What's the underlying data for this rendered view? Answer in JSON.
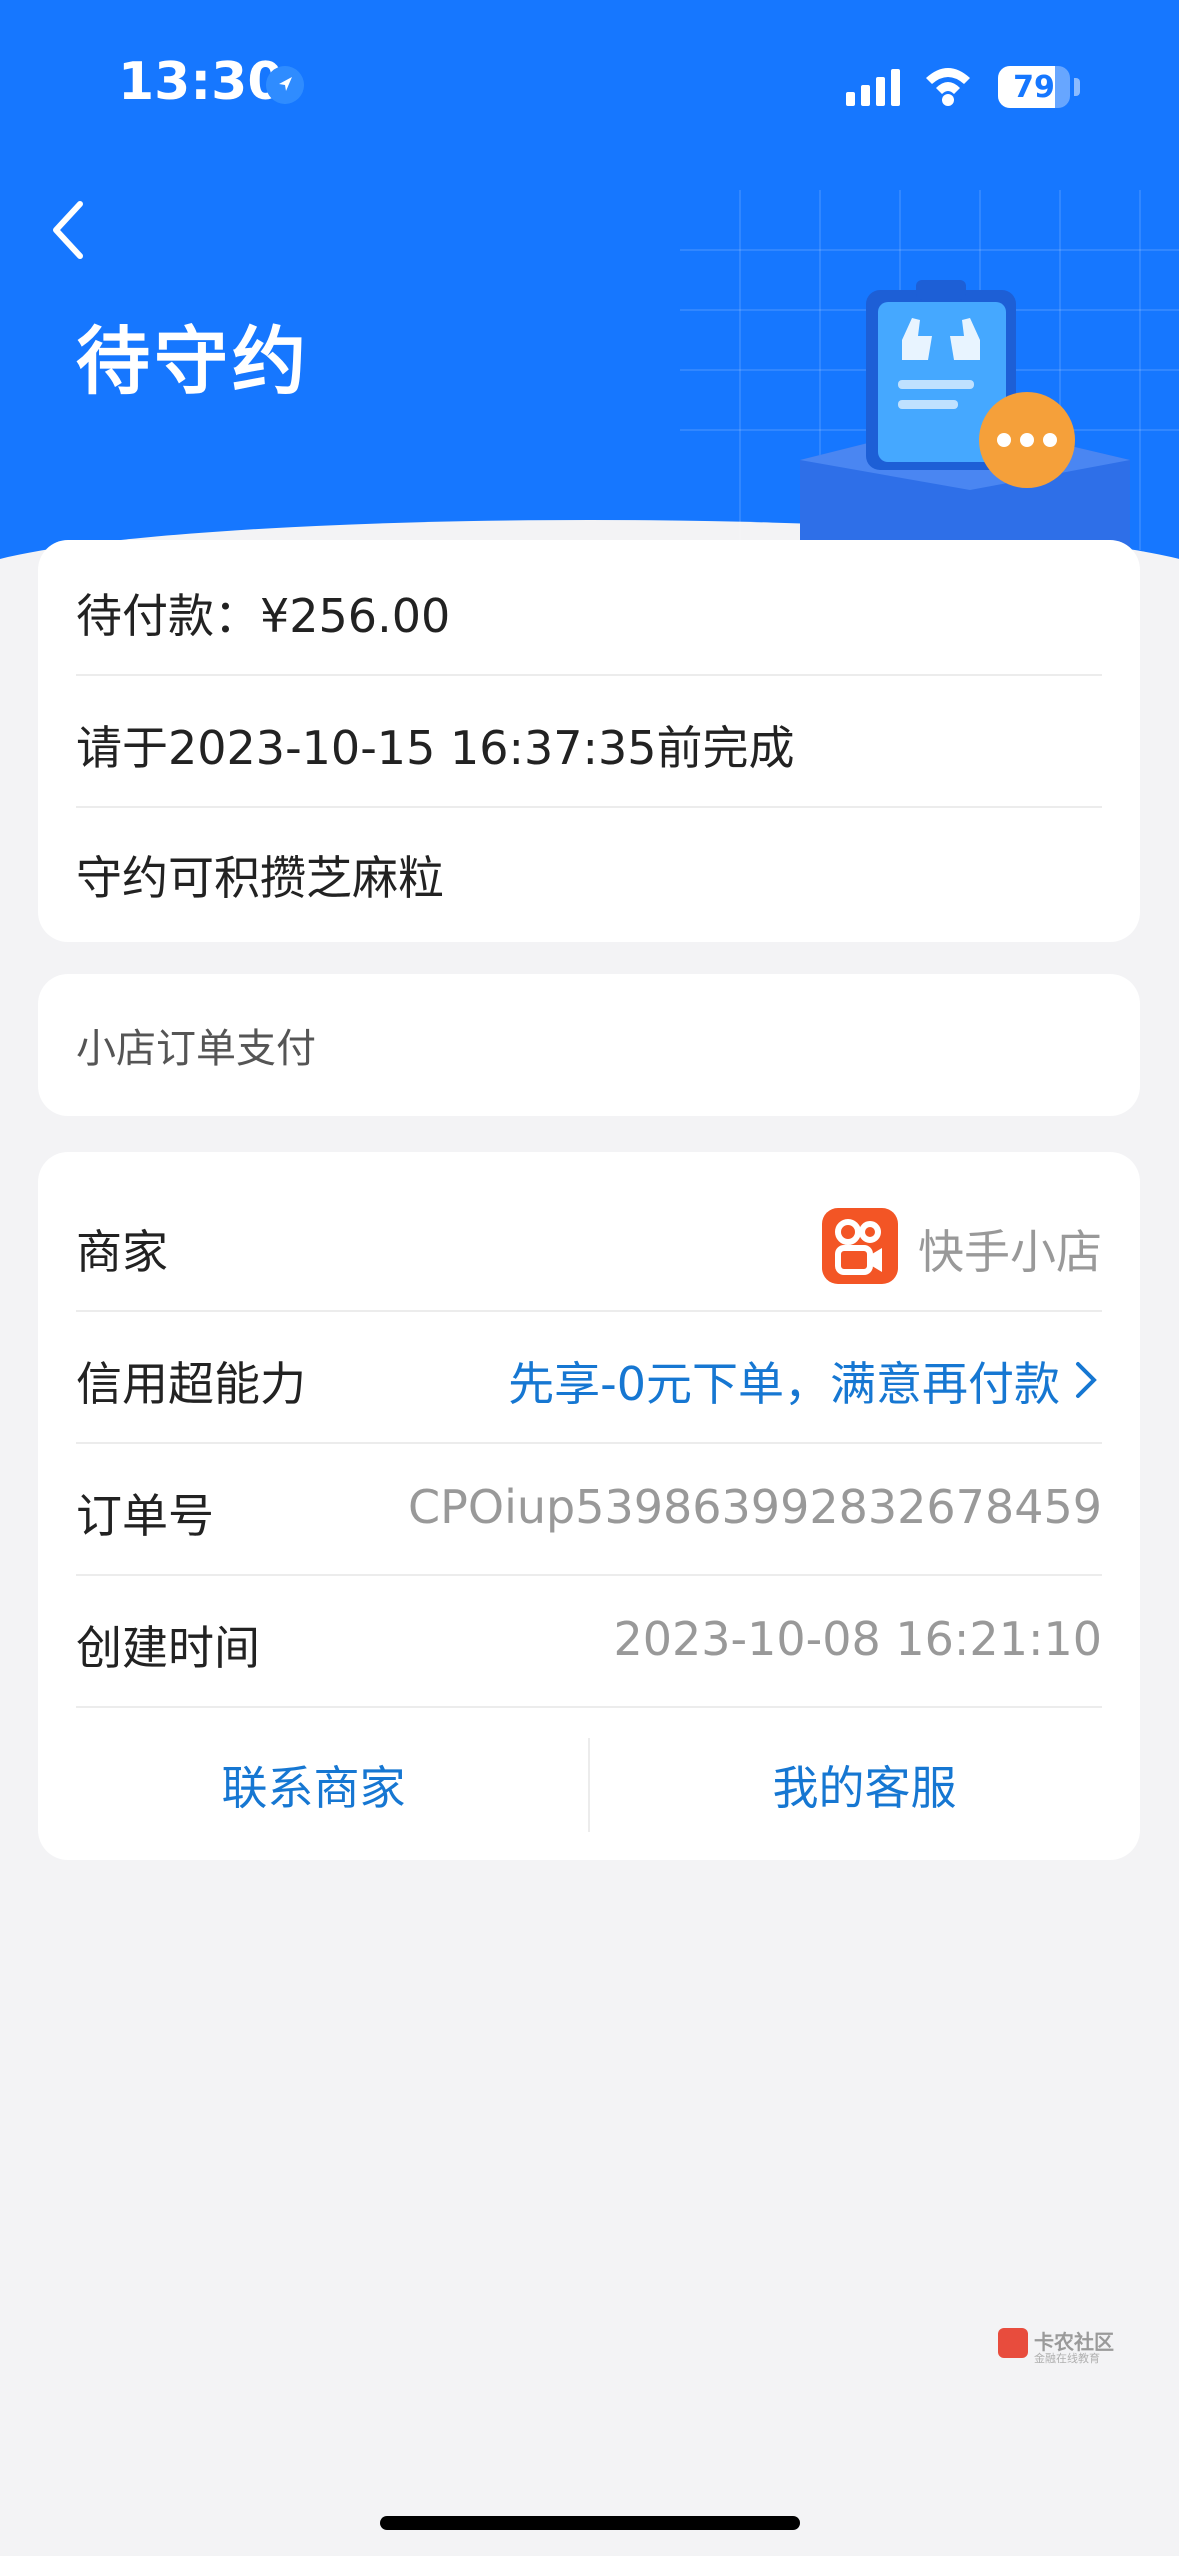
{
  "status_bar": {
    "time": "13:30",
    "battery": "79",
    "battery_level": 0.79
  },
  "header": {
    "title": "待守约"
  },
  "summary": {
    "amount_line": "待付款：¥256.00",
    "deadline_line": "请于2023-10-15 16:37:35前完成",
    "benefit_line": "守约可积攒芝麻粒"
  },
  "order_type": "小店订单支付",
  "details": {
    "merchant_label": "商家",
    "merchant_name": "快手小店",
    "credit_label": "信用超能力",
    "credit_value": "先享-0元下单，满意再付款",
    "order_no_label": "订单号",
    "order_no": "CPOiup53986399283​2678459",
    "created_label": "创建时间",
    "created_value": "2023-10-08 16:21:10",
    "contact_merchant": "联系商家",
    "customer_service": "我的客服"
  },
  "watermark": {
    "text": "卡农社区",
    "sub": "金融在线教育"
  },
  "colors": {
    "header_blue": "#1677ff",
    "link_blue": "#1677d2",
    "kuaishou_orange": "#f35525",
    "badge_orange": "#f5a03a"
  }
}
